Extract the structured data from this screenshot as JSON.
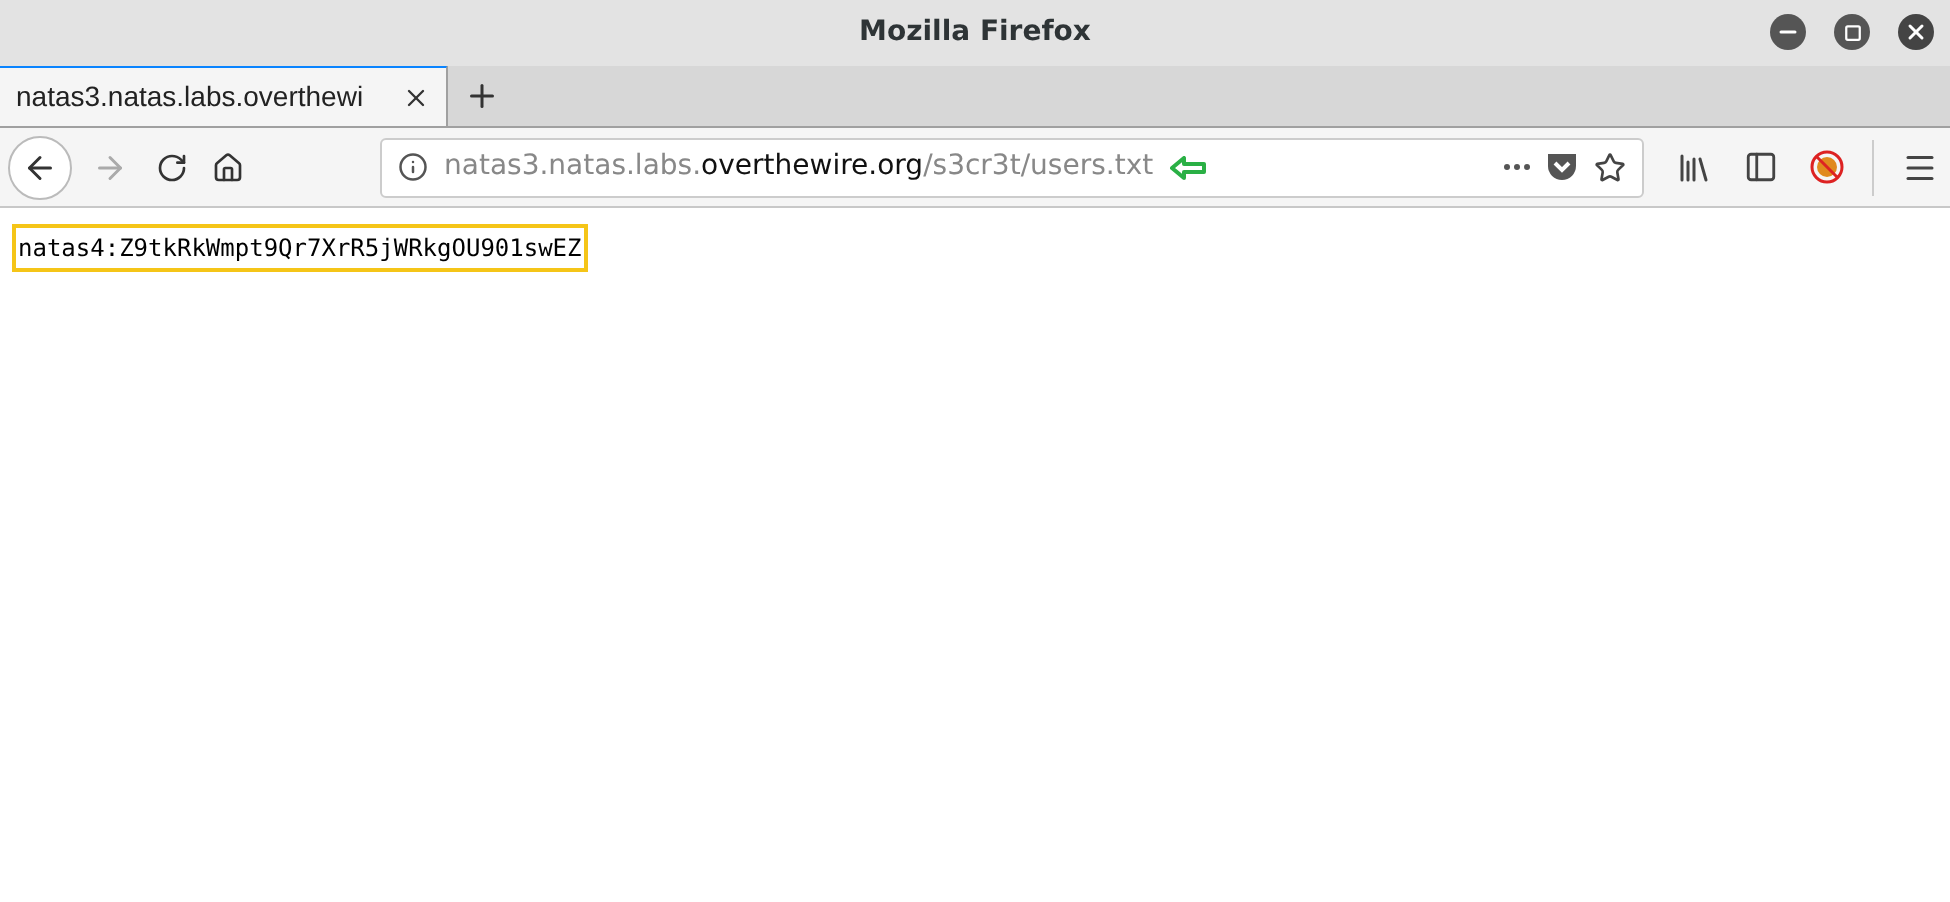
{
  "window": {
    "title": "Mozilla Firefox"
  },
  "tabs": [
    {
      "label": "natas3.natas.labs.overthewi",
      "selected": true
    }
  ],
  "address_bar": {
    "url_parts": [
      {
        "text": "natas3.natas.labs.",
        "kind": "dim"
      },
      {
        "text": "overthewire.org",
        "kind": "domain"
      },
      {
        "text": "/s3cr3t/users.txt",
        "kind": "dim"
      }
    ]
  },
  "content": {
    "text": "natas4:Z9tkRkWmpt9Qr7XrR5jWRkgOU901swEZ",
    "highlighted": true
  }
}
